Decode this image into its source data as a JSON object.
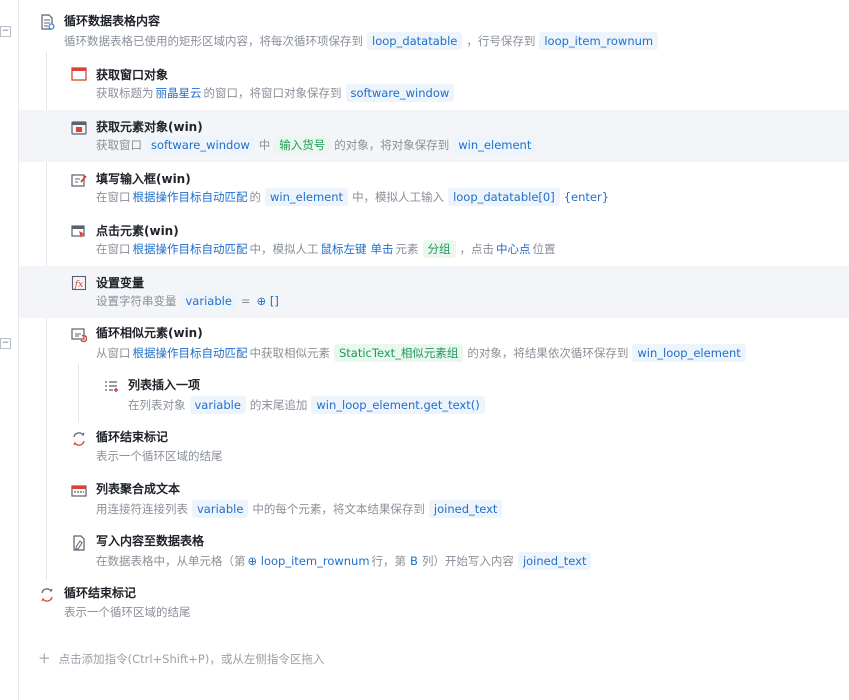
{
  "collapse_symbol": "−",
  "steps": {
    "s1": {
      "title": "循环数据表格内容",
      "d0": "循环数据表格已使用的矩形区域内容，将每次循环项保存到",
      "t1": "loop_datatable",
      "d1": "，行号保存到",
      "t2": "loop_item_rownum"
    },
    "s2": {
      "title": "获取窗口对象",
      "d0": "获取标题为",
      "l1": "丽晶星云",
      "d1": "的窗口，将窗口对象保存到",
      "t1": "software_window"
    },
    "s3": {
      "title": "获取元素对象(win)",
      "d0": "获取窗口",
      "t1": "software_window",
      "d1": "中",
      "t2": "输入货号",
      "d2": "的对象，将对象保存到",
      "t3": "win_element"
    },
    "s4": {
      "title": "填写输入框(win)",
      "d0": "在窗口",
      "l1": "根据操作目标自动匹配",
      "d1": "的",
      "t1": "win_element",
      "d2": "中，模拟人工输入",
      "t2": "loop_datatable[0]",
      "k1": "{enter}"
    },
    "s5": {
      "title": "点击元素(win)",
      "d0": "在窗口",
      "l1": "根据操作目标自动匹配",
      "d1": "中，模拟人工",
      "l2": "鼠标左键",
      "l3": "单击",
      "d2": "元素",
      "t1": "分组",
      "d3": "，点击",
      "l4": "中心点",
      "d4": "位置"
    },
    "s6": {
      "title": "设置变量",
      "d0": "设置字符串变量",
      "t1": "variable",
      "d1": "=",
      "k1": "⊕ []"
    },
    "s7": {
      "title": "循环相似元素(win)",
      "d0": "从窗口",
      "l1": "根据操作目标自动匹配",
      "d1": "中获取相似元素",
      "t1": "StaticText_相似元素组",
      "d2": "的对象，将结果依次循环保存到",
      "t2": "win_loop_element"
    },
    "s8": {
      "title": "列表插入一项",
      "d0": "在列表对象",
      "t1": "variable",
      "d1": "的末尾追加",
      "t2": "win_loop_element.get_text()"
    },
    "s9": {
      "title": "循环结束标记",
      "d0": "表示一个循环区域的结尾"
    },
    "s10": {
      "title": "列表聚合成文本",
      "d0": "用连接符连接列表",
      "t1": "variable",
      "d1": "中的每个元素，将文本结果保存到",
      "t2": "joined_text"
    },
    "s11": {
      "title": "写入内容至数据表格",
      "d0": "在数据表格中，从单元格（第",
      "k1": "⊕ loop_item_rownum",
      "d1": "行，第",
      "k2": "B",
      "d2": "列）开始写入内容",
      "t1": "joined_text"
    },
    "s12": {
      "title": "循环结束标记",
      "d0": "表示一个循环区域的结尾"
    }
  },
  "add_hint": {
    "plus": "+",
    "label": "点击添加指令(Ctrl+Shift+P)，或从左侧指令区拖入"
  },
  "colors": {
    "accent": "#1f6fcc",
    "tag_bg": "#eef4fb",
    "green": "#1f9a55",
    "highlight": "#f3f5f8",
    "icon_red": "#d9433a"
  }
}
